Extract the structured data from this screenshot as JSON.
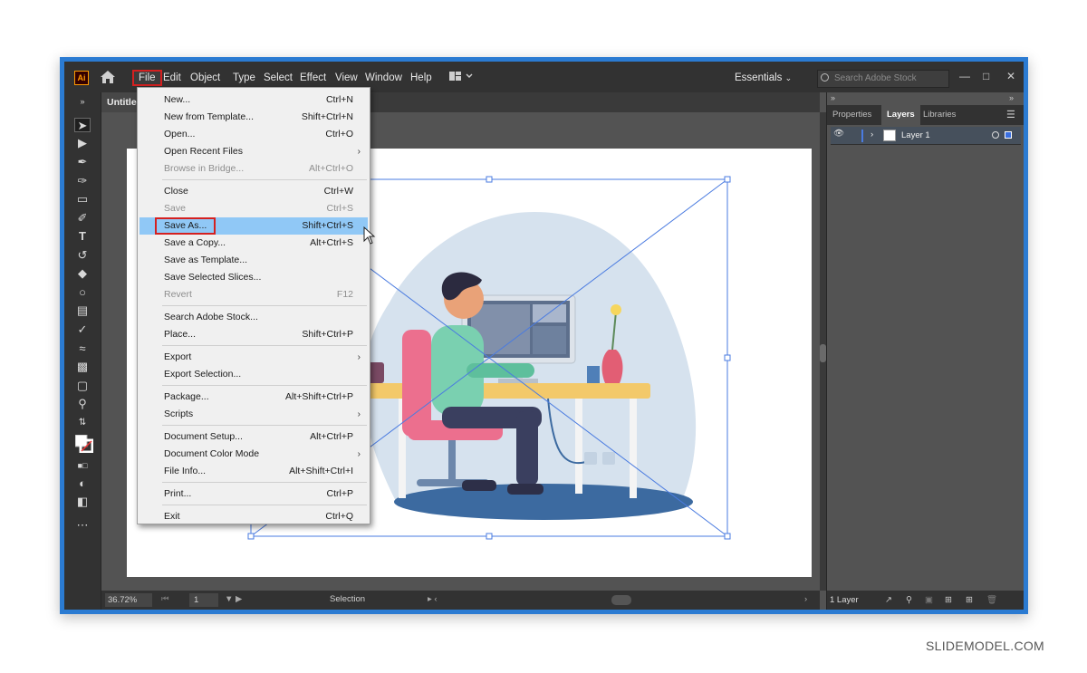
{
  "app": {
    "logo": "Ai",
    "document_tab": "Untitled"
  },
  "menubar": {
    "items": [
      "File",
      "Edit",
      "Object",
      "Type",
      "Select",
      "Effect",
      "View",
      "Window",
      "Help"
    ],
    "workspace": "Essentials",
    "search_placeholder": "Search Adobe Stock"
  },
  "file_menu": {
    "groups": [
      [
        {
          "label": "New...",
          "shortcut": "Ctrl+N"
        },
        {
          "label": "New from Template...",
          "shortcut": "Shift+Ctrl+N"
        },
        {
          "label": "Open...",
          "shortcut": "Ctrl+O"
        },
        {
          "label": "Open Recent Files",
          "submenu": true
        },
        {
          "label": "Browse in Bridge...",
          "shortcut": "Alt+Ctrl+O",
          "disabled": true
        }
      ],
      [
        {
          "label": "Close",
          "shortcut": "Ctrl+W"
        },
        {
          "label": "Save",
          "shortcut": "Ctrl+S",
          "disabled": true
        },
        {
          "label": "Save As...",
          "shortcut": "Shift+Ctrl+S",
          "highlighted": true
        },
        {
          "label": "Save a Copy...",
          "shortcut": "Alt+Ctrl+S"
        },
        {
          "label": "Save as Template..."
        },
        {
          "label": "Save Selected Slices..."
        },
        {
          "label": "Revert",
          "shortcut": "F12",
          "disabled": true
        }
      ],
      [
        {
          "label": "Search Adobe Stock..."
        },
        {
          "label": "Place...",
          "shortcut": "Shift+Ctrl+P"
        }
      ],
      [
        {
          "label": "Export",
          "submenu": true
        },
        {
          "label": "Export Selection..."
        }
      ],
      [
        {
          "label": "Package...",
          "shortcut": "Alt+Shift+Ctrl+P"
        },
        {
          "label": "Scripts",
          "submenu": true
        }
      ],
      [
        {
          "label": "Document Setup...",
          "shortcut": "Alt+Ctrl+P"
        },
        {
          "label": "Document Color Mode",
          "submenu": true
        },
        {
          "label": "File Info...",
          "shortcut": "Alt+Shift+Ctrl+I"
        }
      ],
      [
        {
          "label": "Print...",
          "shortcut": "Ctrl+P"
        }
      ],
      [
        {
          "label": "Exit",
          "shortcut": "Ctrl+Q"
        }
      ]
    ]
  },
  "right_panel": {
    "tabs": [
      "Properties",
      "Layers",
      "Libraries"
    ],
    "active_tab": "Layers",
    "layer_name": "Layer 1",
    "footer": "1 Layer"
  },
  "statusbar": {
    "zoom": "36.72%",
    "artboard": "1",
    "tool": "Selection"
  },
  "watermark": "SLIDEMODEL.COM",
  "colors": {
    "frame_border": "#2b7bd2",
    "highlight": "#90c8f6",
    "callout_red": "#d42020",
    "selection_blue": "#4a7be0"
  }
}
